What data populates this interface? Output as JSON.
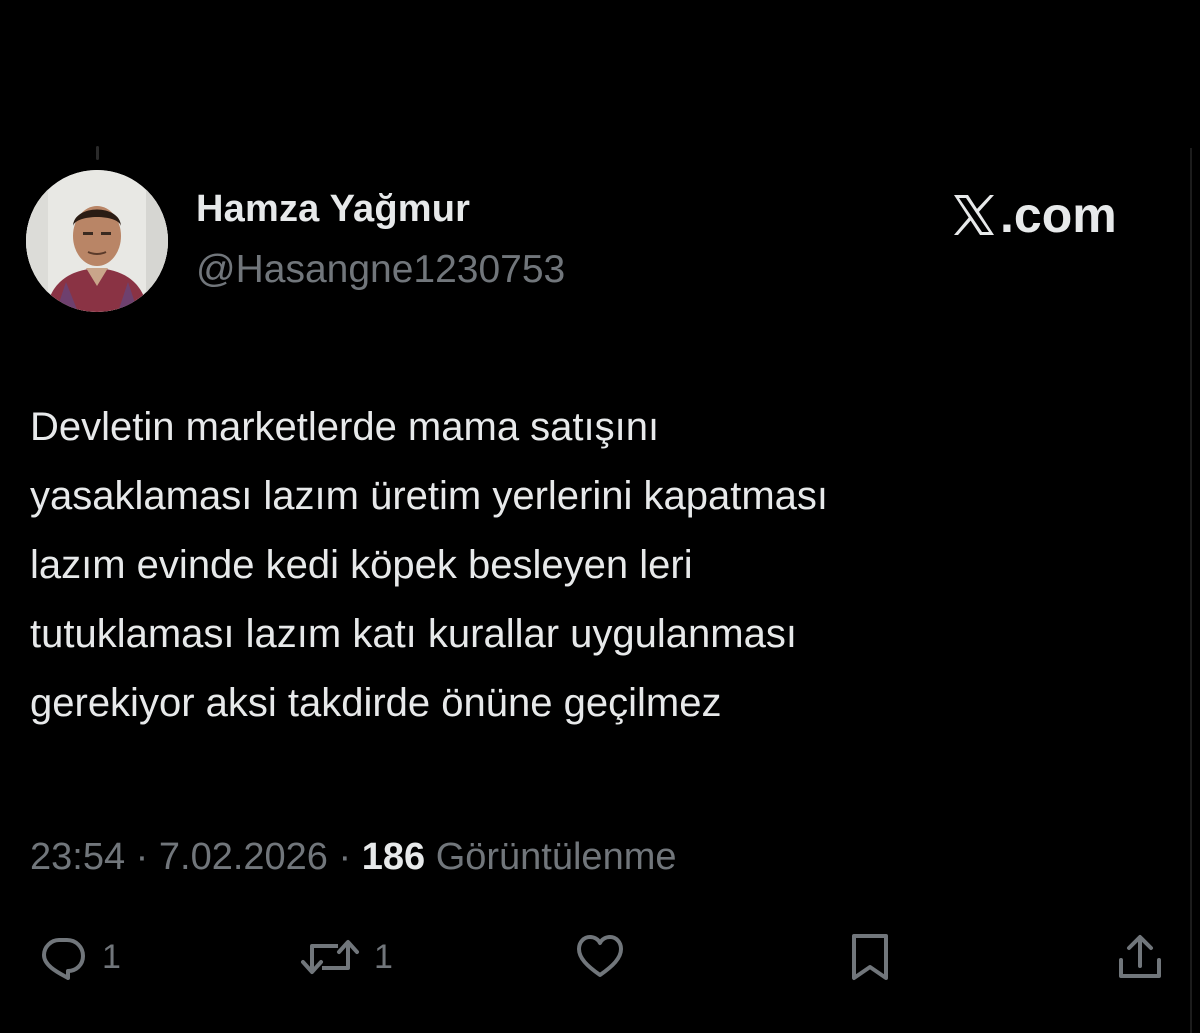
{
  "author": {
    "display_name": "Hamza Yağmur",
    "handle": "@Hasangne1230753",
    "avatar": "profile-photo"
  },
  "brand": {
    "label": ".com",
    "icon": "x-logo"
  },
  "tweet": {
    "lines": [
      "Devletin marketlerde mama satışını",
      "yasaklaması lazım üretim yerlerini kapatması",
      "lazım evinde kedi köpek besleyen leri",
      "tutuklaması lazım katı kurallar uygulanması",
      "gerekiyor aksi takdirde önüne geçilmez"
    ]
  },
  "meta": {
    "time": "23:54",
    "separator": "·",
    "date": "7.02.2026",
    "views_count": "186",
    "views_label": "Görüntülenme"
  },
  "actions": {
    "reply_count": "1",
    "repost_count": "1"
  },
  "colors": {
    "background": "#000000",
    "text_primary": "#e7e9ea",
    "text_secondary": "#71767b"
  }
}
